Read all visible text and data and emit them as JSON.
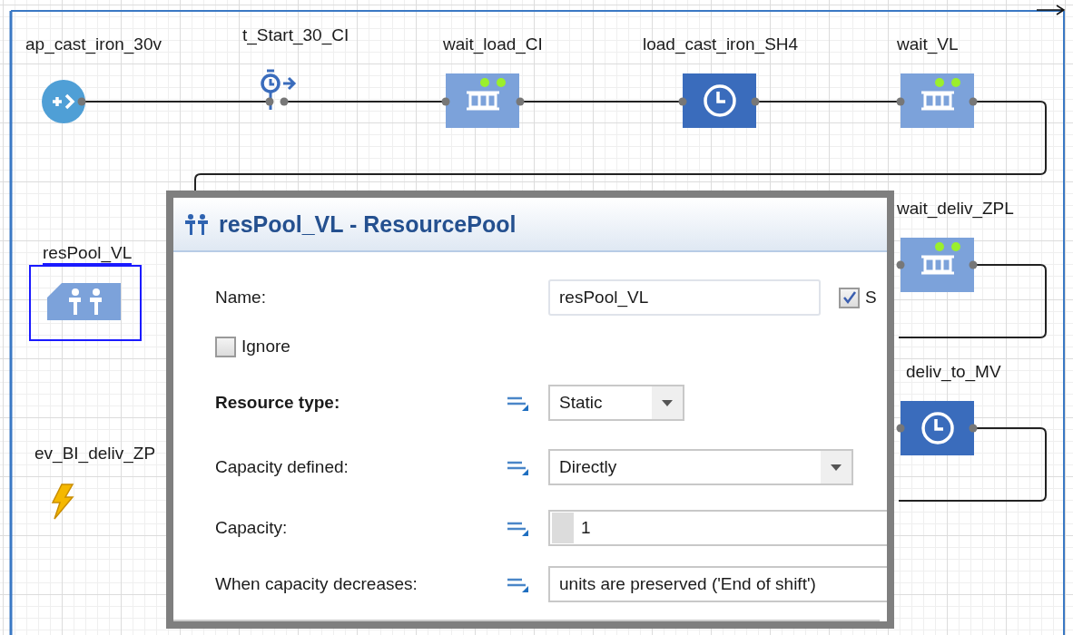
{
  "nodes": [
    {
      "kind": "source",
      "label": "ap_cast_iron_30v",
      "selected": false
    },
    {
      "kind": "timer",
      "label": "t_Start_30_CI",
      "selected": false
    },
    {
      "kind": "queue",
      "label": "wait_load_CI",
      "selected": false
    },
    {
      "kind": "delay",
      "label": "load_cast_iron_SH4",
      "selected": false
    },
    {
      "kind": "queue",
      "label": "wait_VL",
      "selected": false
    },
    {
      "kind": "queue",
      "label": "wait_deliv_ZPL",
      "selected": false
    },
    {
      "kind": "delay",
      "label": "deliv_to_MV",
      "selected": false
    },
    {
      "kind": "pool",
      "label": "resPool_VL",
      "selected": true
    },
    {
      "kind": "event",
      "label": "ev_BI_deliv_ZP",
      "selected": false
    }
  ],
  "dialog": {
    "title": "resPool_VL - ResourcePool",
    "name": {
      "label": "Name:",
      "value": "resPool_VL",
      "show_label": "S",
      "show_checked": true
    },
    "ignore": {
      "label": "Ignore",
      "checked": false
    },
    "rows": [
      {
        "kind": "dropdown",
        "label": "Resource type:",
        "emphasized": true,
        "value": "Static"
      },
      {
        "kind": "dropdown",
        "label": "Capacity defined:",
        "emphasized": false,
        "value": "Directly"
      },
      {
        "kind": "number",
        "label": "Capacity:",
        "emphasized": false,
        "value": "1"
      },
      {
        "kind": "text",
        "label": "When capacity decreases:",
        "emphasized": false,
        "value": "units are preserved ('End of shift')"
      }
    ]
  }
}
